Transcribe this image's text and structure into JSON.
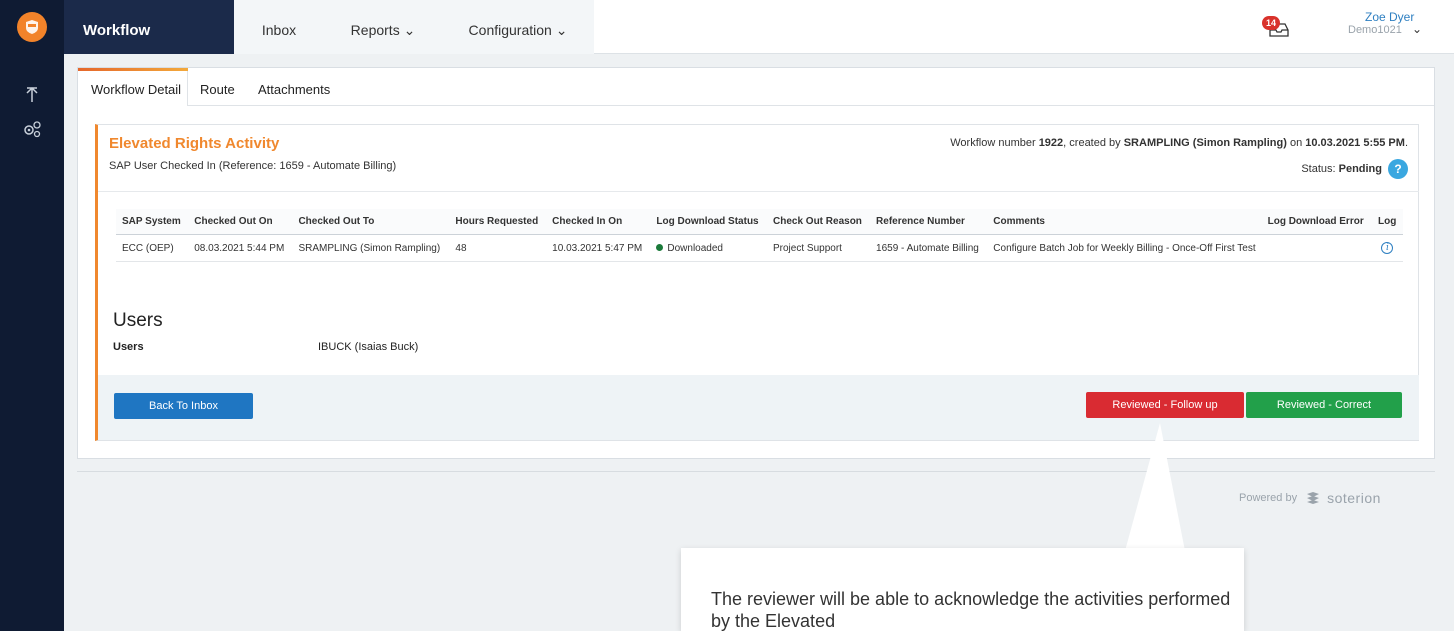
{
  "app": {
    "brand": "Workflow",
    "nav": [
      {
        "label": "Inbox"
      },
      {
        "label": "Reports ⌄"
      },
      {
        "label": "Configuration ⌄"
      }
    ],
    "notifications_count": "14",
    "user": {
      "name": "Zoe Dyer",
      "sub": "Demo1021",
      "chevron": "⌄"
    }
  },
  "sidebar": {
    "icons": [
      "upload-arrow-icon",
      "settings-gears-icon"
    ]
  },
  "tabs": [
    {
      "label": "Workflow Detail"
    },
    {
      "label": "Route"
    },
    {
      "label": "Attachments"
    }
  ],
  "card": {
    "title": "Elevated Rights Activity",
    "subtitle": "SAP User Checked In (Reference: 1659 - Automate Billing)",
    "wf_prefix": "Workflow number ",
    "wf_number": "1922",
    "wf_created": ", created by ",
    "wf_user": "SRAMPLING (Simon Rampling)",
    "wf_on": " on ",
    "wf_date": "10.03.2021 5:55 PM",
    "wf_end": ".",
    "status_label": "Status: ",
    "status_value": "Pending"
  },
  "table": {
    "headers": [
      "SAP System",
      "Checked Out On",
      "Checked Out To",
      "Hours Requested",
      "Checked In On",
      "Log Download Status",
      "Check Out Reason",
      "Reference Number",
      "Comments",
      "Log Download Error",
      "Log"
    ],
    "rows": [
      {
        "sap_system": "ECC (OEP)",
        "checked_out_on": "08.03.2021 5:44 PM",
        "checked_out_to": "SRAMPLING (Simon Rampling)",
        "hours_requested": "48",
        "checked_in_on": "10.03.2021 5:47 PM",
        "log_download_status": "Downloaded",
        "check_out_reason": "Project Support",
        "reference_number": "1659 - Automate Billing",
        "comments": "Configure Batch Job for Weekly Billing - Once-Off First Test",
        "log_download_error": "",
        "log": "i"
      }
    ]
  },
  "users": {
    "heading": "Users",
    "label": "Users",
    "value": "IBUCK (Isaias Buck)"
  },
  "buttons": {
    "back": "Back To Inbox",
    "follow_up": "Reviewed - Follow up",
    "correct": "Reviewed - Correct"
  },
  "footer": {
    "powered_by": "Powered by",
    "brand": "soterion"
  },
  "callout": {
    "text": "The reviewer will be able to acknowledge the activities performed by the Elevated"
  },
  "colors": {
    "accent_orange": "#f0882e",
    "primary_blue": "#1f76c2",
    "danger_red": "#d92b32",
    "success_green": "#22a04a",
    "nav_dark": "#0f1b33"
  }
}
